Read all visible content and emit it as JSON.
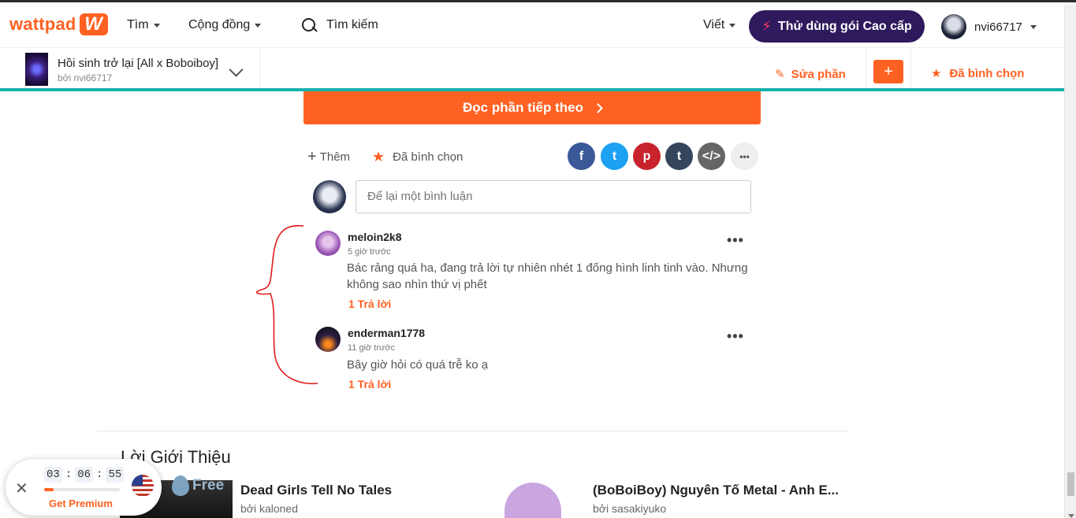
{
  "nav": {
    "logo_text": "wattpad",
    "logo_mark": "W",
    "browse_label": "Tìm",
    "community_label": "Cộng đồng",
    "search_label": "Tìm kiếm",
    "write_label": "Viết",
    "premium_button": "Thử dùng gói Cao cấp",
    "username": "nvi66717"
  },
  "story": {
    "title": "Hồi sinh trở lại [All x Boboiboy]",
    "author": "bởi nvi66717",
    "edit_label": "Sửa phần",
    "add_label": "+",
    "voted_label": "Đã bình chọn"
  },
  "main": {
    "next_part_label": "Đọc phần tiếp theo",
    "add_label": "Thêm",
    "voted_label": "Đã bình chọn",
    "share": [
      {
        "name": "facebook",
        "glyph": "f",
        "color": "#3b5998"
      },
      {
        "name": "twitter",
        "glyph": "t",
        "color": "#1da1f2"
      },
      {
        "name": "pinterest",
        "glyph": "p",
        "color": "#c8232c"
      },
      {
        "name": "tumblr",
        "glyph": "t",
        "color": "#35465c"
      },
      {
        "name": "embed",
        "glyph": "</>",
        "color": "#666666"
      },
      {
        "name": "more",
        "glyph": "•••",
        "color": "#eeeeee"
      }
    ],
    "comment_placeholder": "Để lại một bình luận"
  },
  "comments": [
    {
      "username": "meloin2k8",
      "time": "5 giờ trước",
      "text": "Bác rảng quá ha, đang trả lời tự nhiên nhét 1 đống hình linh tinh vào. Nhưng không sao nhìn thứ vị phết",
      "replies": "1 Trả lời"
    },
    {
      "username": "enderman1778",
      "time": "11 giờ trước",
      "text": "Bây giờ hỏi có quá trễ ko ạ",
      "replies": "1 Trả lời"
    }
  ],
  "recommendations": {
    "section_title": "Lời Giới Thiệu",
    "items": [
      {
        "title": "Dead Girls Tell No Tales",
        "author": "bởi kaloned",
        "badge": "Free"
      },
      {
        "title": "(BoBoiBoy) Nguyên Tố Metal - Anh E...",
        "author": "bởi sasakiyuko"
      }
    ]
  },
  "timer": {
    "hours": "03",
    "minutes": "06",
    "seconds": "55",
    "cta": "Get Premium",
    "progress": 0.12
  },
  "colors": {
    "brand": "#ff6122",
    "premium": "#2e1a5c",
    "teal": "#17b1ad"
  }
}
